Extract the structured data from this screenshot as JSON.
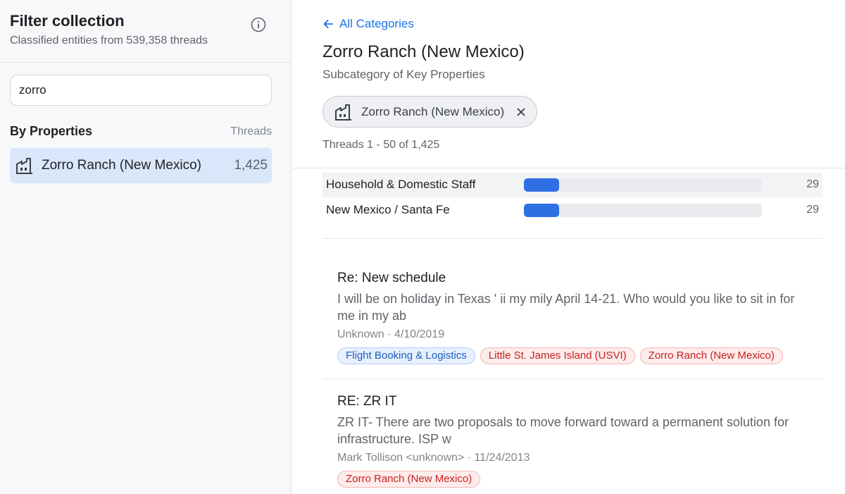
{
  "sidebar": {
    "title": "Filter collection",
    "subtitle": "Classified entities from 539,358 threads",
    "search_value": "zorro",
    "section_title": "By Properties",
    "column_label": "Threads",
    "items": [
      {
        "label": "Zorro Ranch (New Mexico)",
        "count": "1,425",
        "icon": "building-icon"
      }
    ]
  },
  "main": {
    "back_label": "All Categories",
    "title": "Zorro Ranch (New Mexico)",
    "subtitle": "Subcategory of Key Properties",
    "active_filter": {
      "label": "Zorro Ranch (New Mexico)",
      "icon": "building-icon"
    },
    "thread_count": "Threads 1 - 50 of 1,425",
    "stats": [
      {
        "label": "Household & Domestic Staff",
        "count": "29",
        "fill_fraction": 0.148
      },
      {
        "label": "New Mexico / Santa Fe",
        "count": "29",
        "fill_fraction": 0.148
      }
    ],
    "threads": [
      {
        "title": "Re: New schedule",
        "snippet": "I will be on holiday in Texas ' ii my mily April 14-21. Who would you like to sit in for me in my ab",
        "meta": "Unknown · 4/10/2019",
        "tags": [
          {
            "label": "Flight Booking & Logistics",
            "color": "blue"
          },
          {
            "label": "Little St. James Island (USVI)",
            "color": "red"
          },
          {
            "label": "Zorro Ranch (New Mexico)",
            "color": "red"
          }
        ]
      },
      {
        "title": "RE: ZR IT",
        "snippet": "ZR IT- There are two proposals to move forward toward a permanent solution for infrastructure. ISP w",
        "meta": "Mark Tollison <unknown> · 11/24/2013",
        "tags": [
          {
            "label": "Zorro Ranch (New Mexico)",
            "color": "red"
          }
        ]
      }
    ]
  },
  "colors": {
    "accent": "#1a73e8",
    "bar_fill": "#2f6fe4",
    "selected_bg": "#d9e7fb",
    "tag_blue_text": "#1a5fc2",
    "tag_red_text": "#c5221f"
  }
}
